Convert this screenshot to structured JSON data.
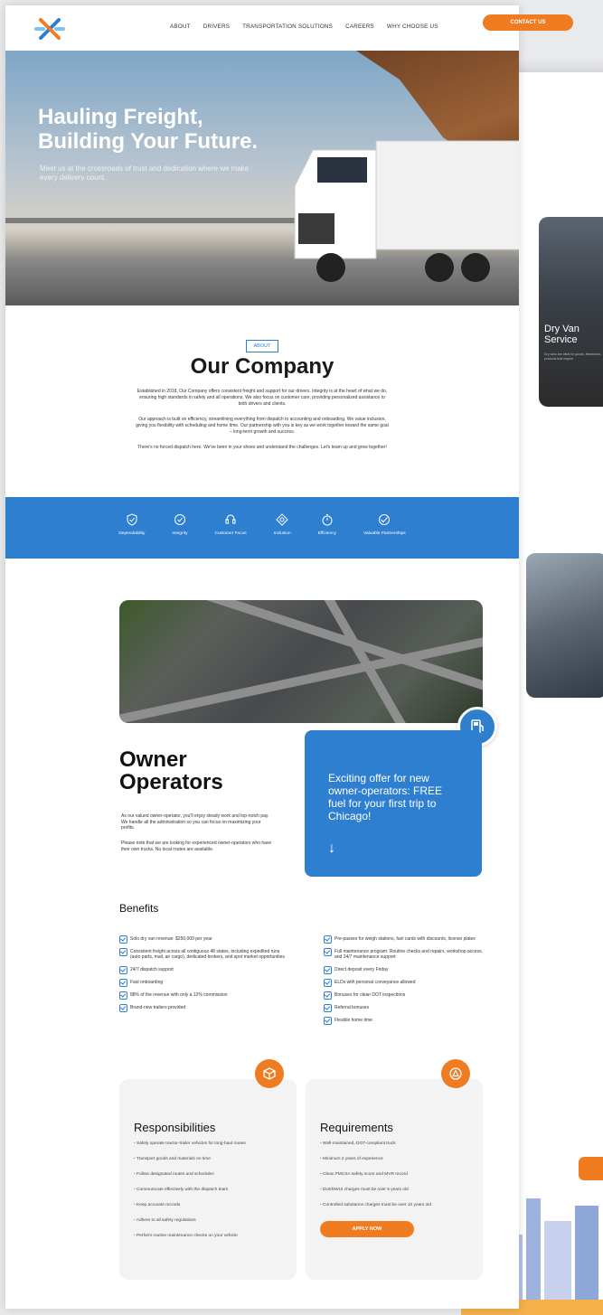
{
  "nav": {
    "items": [
      "ABOUT",
      "DRIVERS",
      "TRANSPORTATION SOLUTIONS",
      "CAREERS",
      "WHY CHOOSE US"
    ],
    "contact_label": "CONTACT US"
  },
  "hero": {
    "title_line1": "Hauling Freight,",
    "title_line2": "Building Your Future.",
    "subtitle": "Meet us at the crossroads of trust and dedication where we make every delivery count."
  },
  "about": {
    "tag": "ABOUT",
    "title": "Our Company",
    "p1": "Established in 2018, Our Company offers consistent freight and support for our drivers. Integrity is at the heart of what we do, ensuring high standards in safety and all operations. We also focus on customer care, providing personalized assistance to both drivers and clients.",
    "p2": "Our approach is built on efficiency, streamlining everything from dispatch to accounting and onboarding. We value inclusion, giving you flexibility with scheduling and home time. Our partnership with you is key as we work together toward the same goal – long-term growth and success.",
    "p3": "There's no forced dispatch here. We've been in your shoes and understand the challenges. Let's team up and grow together!"
  },
  "values": [
    {
      "label": "Dependability",
      "icon": "shield-check-icon"
    },
    {
      "label": "Integrity",
      "icon": "badge-check-icon"
    },
    {
      "label": "Customer Focus",
      "icon": "headset-icon"
    },
    {
      "label": "Inclusion",
      "icon": "handshake-icon"
    },
    {
      "label": "Efficiency",
      "icon": "stopwatch-icon"
    },
    {
      "label": "Valuable Partnerships",
      "icon": "partnership-icon"
    }
  ],
  "owner": {
    "title_line1": "Owner",
    "title_line2": "Operators",
    "p1": "As our valued owner-operator, you'll enjoy steady work and top-notch pay. We handle all the administration so you can focus on maximizing your profits.",
    "p2": "Please note that we are looking for experienced owner-operators who have their own trucks. No local routes are available.",
    "offer": "Exciting offer for new owner-operators: FREE fuel for your first trip to Chicago!"
  },
  "benefits": {
    "title": "Benefits",
    "left": [
      "Solo dry van revenue: $250,000 per year",
      "Consistent freight across all contiguous 48 states, including expedited runs (auto parts, mail, air cargo), dedicated brokers, and spot market opportunities",
      "24/7 dispatch support",
      "Fast onboarding",
      "88% of the revenue with only a 12% commission",
      "Brand-new trailers provided"
    ],
    "right": [
      "Pre-passes for weigh stations, fuel cards with discounts, license plates",
      "Full maintenance program: Routine checks and repairs, workshop access, and 24/7 maintenance support",
      "Direct deposit every Friday",
      "ELDs with personal conveyance allowed",
      "Bonuses for clean DOT inspections",
      "Referral bonuses",
      "Flexible home time"
    ]
  },
  "responsibilities": {
    "title": "Responsibilities",
    "items": [
      "Safely operate tractor-trailer vehicles for long-haul routes",
      "Transport goods and materials on time",
      "Follow designated routes and schedules",
      "Communicate effectively with the dispatch team",
      "Keep accurate records",
      "Adhere to all safety regulations",
      "Perform routine maintenance checks on your vehicle"
    ]
  },
  "requirements": {
    "title": "Requirements",
    "items": [
      "Well-maintained, DOT-compliant truck",
      "Minimum 2 years of experience",
      "Clean FMCSA safety score and MVR record",
      "DUI/DWUI charges must be over 5 years old",
      "Controlled substance charges must be over 10 years old"
    ],
    "apply_label": "APPLY NOW"
  },
  "side": {
    "service_title_line1": "Dry Van",
    "service_title_line2": "Service",
    "service_text": "Dry vans are ideal for goods, electronics, products that require"
  },
  "colors": {
    "brand_blue": "#2f7fd1",
    "brand_orange": "#f07c22"
  }
}
